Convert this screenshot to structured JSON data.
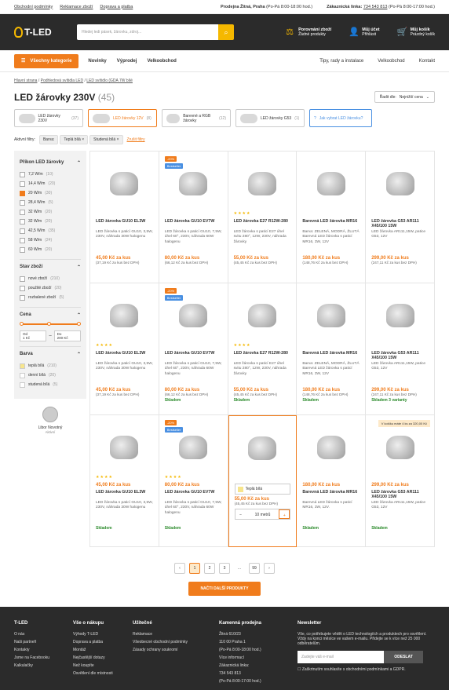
{
  "topbar": {
    "links": [
      "Obchodní podmínky",
      "Reklamace zboží",
      "Doprava a platba"
    ],
    "store": "Prodejna Žitná, Praha",
    "store_hours": "(Po-Pá 8:00-18:00 hod.)",
    "phone_label": "Zákaznická linka:",
    "phone": "734 543 813",
    "phone_hours": "(Po-Pá 8:00-17:00 hod.)"
  },
  "header": {
    "logo": "T-LED",
    "search_placeholder": "Hledej ledi pásek, žárovku, zdroj...",
    "compare": "Porovnání zboží",
    "compare_sub": "Žádné produkty",
    "account": "Můj účet",
    "account_sub": "Přihlásit",
    "cart": "Můj košík",
    "cart_sub": "Prázdný košík",
    "cart_count": "0"
  },
  "nav": {
    "categories": "Všechny kategorie",
    "main": [
      "Novinky",
      "Výprodej",
      "Velkoobchod"
    ],
    "right": [
      "Tipy, rady a instalace",
      "Velkoobchod",
      "Kontakt"
    ]
  },
  "breadcrumb": [
    "Hlavní strana",
    "Podhledová svítidla LED",
    "LED svítidlo (GDA 7W bílé"
  ],
  "title": "LED žárovky 230V",
  "title_count": "(45)",
  "sort": {
    "label": "Řadit dle:",
    "value": "Nejnižší cena"
  },
  "chips": [
    {
      "label": "LED žárovky 230V",
      "n": "(37)"
    },
    {
      "label": "LED žárovky 12V",
      "n": "(8)"
    },
    {
      "label": "Barevné a RGB žárovky",
      "n": "(12)"
    },
    {
      "label": "LED žárovky G53",
      "n": "(1)"
    },
    {
      "label": "Jak vybrat LED žárovku?",
      "n": ""
    }
  ],
  "filters": {
    "label": "Aktivní filtry:",
    "color": "Barva:",
    "tags": [
      "Teplá bílá ×",
      "Studená bílá ×"
    ],
    "clear": "Zrušit filtry"
  },
  "sidebar": {
    "power_title": "Příkon LED žárovky",
    "power": [
      {
        "l": "7,2 W/m",
        "n": "(10)"
      },
      {
        "l": "14,4 W/m",
        "n": "(20)"
      },
      {
        "l": "20 W/m",
        "n": "(30)"
      },
      {
        "l": "28,4 W/m",
        "n": "(5)"
      },
      {
        "l": "32 W/m",
        "n": "(20)"
      },
      {
        "l": "32 W/m",
        "n": "(20)"
      },
      {
        "l": "42,5 W/m",
        "n": "(35)"
      },
      {
        "l": "58 W/m",
        "n": "(24)"
      },
      {
        "l": "60 W/m",
        "n": "(20)"
      }
    ],
    "state_title": "Stav zboží",
    "state": [
      {
        "l": "nové zboží",
        "n": "(210)"
      },
      {
        "l": "použité zboží",
        "n": "(20)"
      },
      {
        "l": "rozbalené zboží",
        "n": "(5)"
      }
    ],
    "price_title": "Cena",
    "from": "Od",
    "from_v": "1 Kč",
    "to": "Do",
    "to_v": "200 Kč",
    "color_title": "Barva",
    "colors": [
      {
        "l": "teplá bílá",
        "n": "(210)"
      },
      {
        "l": "denní bílá",
        "n": "(20)"
      },
      {
        "l": "studená bílá",
        "n": "(5)"
      }
    ],
    "agent": "Libor Novotný",
    "agent_status": "Aktivní"
  },
  "products": [
    {
      "name": "LED žárovka GU10 EL3W",
      "desc": "LED žárovka s paticí GU10, 3,5W, 230V, náhrada 30W halogenu",
      "price": "45,00 Kč za kus",
      "net": "(37,19 Kč za kus bez DPH)",
      "stock": ""
    },
    {
      "name": "LED žárovka GU10 EV7W",
      "desc": "LED žárovka s paticí GU10, 7,5W, úhel 60°, 230V, náhrada 60W halogenu",
      "price": "80,00 Kč za kus",
      "net": "(66,12 Kč za kus bez DPH)",
      "stock": "",
      "badge": "-20%",
      "badge2": "Bestseller"
    },
    {
      "name": "LED žárovka E27 R12W-280",
      "desc": "LED žárovka s paticí E27 úhel svitu 280°, 12W, 230V, náhrada žárovky",
      "price": "55,00 Kč za kus",
      "net": "(45,45 Kč za kus bez DPH)",
      "stock": "",
      "stars": "★★★★"
    },
    {
      "name": "Barevná LED žárovka MR16",
      "desc": "Barva: ZELENÁ, MODRÁ, ŽLUTÁ Barevná LED žárovka s paticí MR16, 3W, 12V",
      "price": "180,00 Kč za kus",
      "net": "(148,76 Kč za kus bez DPH)",
      "stock": ""
    },
    {
      "name": "LED žárovka G53 AR111 X45/100 15W",
      "desc": "LED žárovka AR111,15W, patice G53, 12V",
      "price": "299,00 Kč za kus",
      "net": "(247,11 Kč za kus bez DPH)",
      "stock": ""
    },
    {
      "name": "LED žárovka GU10 EL3W",
      "desc": "LED žárovka s paticí GU10, 3,5W, 230V, náhrada 30W halogenu",
      "price": "45,00 Kč za kus",
      "net": "(37,19 Kč za kus bez DPH)",
      "stock": "",
      "stars": "★★★★"
    },
    {
      "name": "LED žárovka GU10 EV7W",
      "desc": "LED žárovka s paticí GU10, 7,5W, úhel 60°, 230V, náhrada 60W halogenu",
      "price": "80,00 Kč za kus",
      "net": "(66,12 Kč za kus bez DPH)",
      "stock": "Skladem",
      "badge": "-20%",
      "badge2": "Bestseller"
    },
    {
      "name": "LED žárovka E27 R12W-280",
      "desc": "LED žárovka s paticí E27 úhel svitu 280°, 12W, 230V, náhrada žárovky",
      "price": "55,00 Kč za kus",
      "net": "(45,45 Kč za kus bez DPH)",
      "stock": "Skladem",
      "stars": "★★★★"
    },
    {
      "name": "Barevná LED žárovka MR16",
      "desc": "Barva: ZELENÁ, MODRÁ, ŽLUTÁ Barevná LED žárovka s paticí MR16, 3W, 12V",
      "price": "180,00 Kč za kus",
      "net": "(148,76 Kč za kus bez DPH)",
      "stock": "Skladem"
    },
    {
      "name": "LED žárovka G53 AR111 X45/100 15W",
      "desc": "LED žárovka AR111,15W, patice G53, 12V",
      "price": "299,00 Kč za kus",
      "net": "(247,11 Kč za kus bez DPH)",
      "stock": "Skladem 3 varianty"
    },
    {
      "name": "LED žárovka GU10 EL3W",
      "desc": "LED žárovka s paticí GU10, 3,5W, 230V, náhrada 30W halogenu",
      "price": "45,00 Kč za kus",
      "net": "",
      "stock": "Skladem",
      "stars": "★★★★"
    },
    {
      "name": "LED žárovka GU10 EV7W",
      "desc": "LED žárovka s paticí GU10, 7,5W, úhel 60°, 230V, náhrada 60W halogenu",
      "price": "80,00 Kč za kus",
      "net": "",
      "stock": "Skladem",
      "badge": "-20%",
      "badge2": "Bestseller",
      "stars": "★★★★"
    },
    {
      "name": "",
      "desc": "",
      "price": "55,00 Kč za kus",
      "net": "(45,45 Kč za kus bez DPH)",
      "stock": "",
      "variant": "Teplá bílá",
      "qty": "10 metrů"
    },
    {
      "name": "Barevná LED žárovka MR16",
      "desc": "Barevná LED žárovka s paticí MR16, 3W, 12V.",
      "price": "180,00 Kč za kus",
      "net": "",
      "stock": "Skladem"
    },
    {
      "name": "LED žárovka G53 AR111 X45/100 15W",
      "desc": "LED žárovka AR111,15W, patice G53, 12V",
      "price": "299,00 Kč za kus",
      "net": "",
      "stock": "Skladem",
      "note": "V košíku máte 4 ks za 320,00 Kč"
    }
  ],
  "pager": {
    "prev": "‹",
    "pages": [
      "1",
      "2",
      "3",
      "...",
      "99"
    ],
    "next": "›"
  },
  "load_more": "NAČTI DALŠÍ PRODUKTY",
  "footer": {
    "c1_title": "T-LED",
    "c1": [
      "O nás",
      "Naši partneři",
      "Kontakty",
      "Jsme na Facebooku",
      "Kalkulačky"
    ],
    "c2_title": "Vše o nákupu",
    "c2": [
      "Výhody T-LED",
      "Doprava a platba",
      "Montáž",
      "Nejčastější dotazy",
      "Než koupíte",
      "Osvětlení dle místnosti"
    ],
    "c3_title": "Užitečné",
    "c3": [
      "Reklamace",
      "Všeobecné obchodní podmínky",
      "Zásady ochrany soukromí"
    ],
    "c4_title": "Kamenná prodejna",
    "c4": [
      "Žitná 610/23",
      "110 00 Praha 1",
      "(Po-Pá 8:00-18:00 hod.)",
      "Více informací",
      "Zákaznická linka:",
      "734 543 813",
      "(Po-Pá 8:00-17:00 hod.)"
    ],
    "c5_title": "Newsletter",
    "c5_text": "Vše, co potřebujete vědět o LED technologiích a produktech pro osvětlení. Vždy na konci měsíce ve vašem e-mailu. Přidejte se k více než 25 000 odběratelům.",
    "email_placeholder": "Zadejte váš e-mail",
    "subscribe": "ODESLAT",
    "consent": "Zaškrtnutím souhlasíte s obchodními podmínkami a GDPR."
  }
}
